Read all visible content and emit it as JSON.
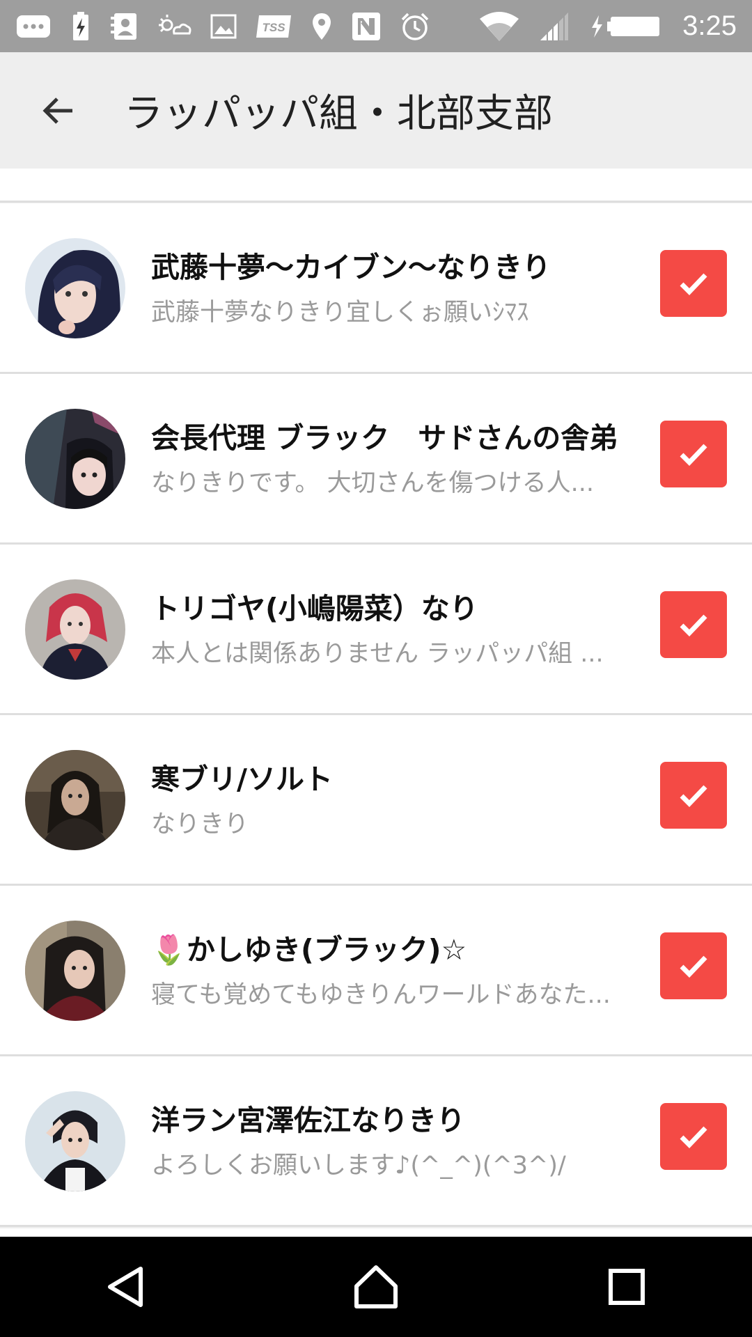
{
  "status_bar": {
    "time": "3:25",
    "icons": [
      "messages-icon",
      "battery-charging-small-icon",
      "contacts-icon",
      "weather-icon",
      "image-icon",
      "tss-icon",
      "location-icon",
      "nfc-icon",
      "alarm-icon",
      "wifi-icon",
      "signal-icon",
      "battery-icon"
    ],
    "tss_label": "TSS"
  },
  "app_bar": {
    "back_icon": "arrow-back-icon",
    "title": "ラッパッパ組・北部支部"
  },
  "colors": {
    "accent": "#f44a45",
    "status_bar": "#9e9e9e",
    "app_bar": "#eeeeee"
  },
  "members": [
    {
      "name": "武藤十夢〜カイブン〜なりきり",
      "desc": "武藤十夢なりきり宜しくぉ願いｼﾏｽ",
      "checked": true
    },
    {
      "name": "会長代理 ブラック　サドさんの舎弟",
      "desc": "なりきりです。 大切さんを傷つける人...",
      "checked": true
    },
    {
      "name": "トリゴヤ(小嶋陽菜）なり",
      "desc": "本人とは関係ありません ラッパッパ組 ...",
      "checked": true
    },
    {
      "name": "寒ブリ/ソルト",
      "desc": "なりきり",
      "checked": true
    },
    {
      "name": "🌷かしゆき(ブラック)☆",
      "desc": "寝ても覚めてもゆきりんワールドあなた...",
      "checked": true
    },
    {
      "name": "洋ラン宮澤佐江なりきり",
      "desc": "よろしくお願いします♪(^_^)(^3^)/",
      "checked": true
    }
  ],
  "nav_bar": {
    "back": "nav-back-icon",
    "home": "nav-home-icon",
    "recents": "nav-recents-icon"
  }
}
